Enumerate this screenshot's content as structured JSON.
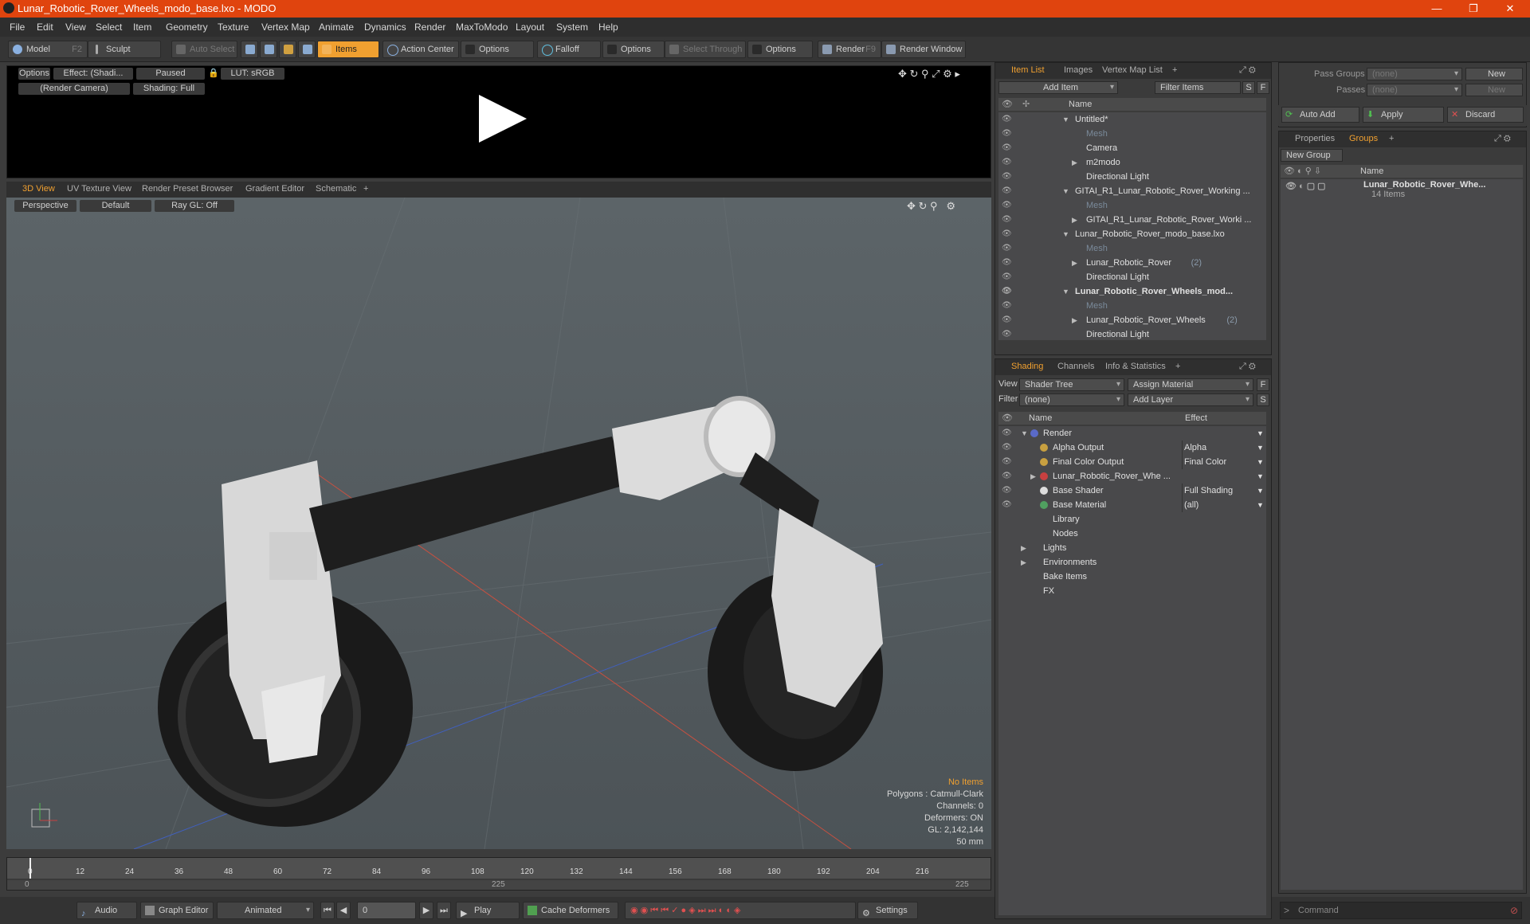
{
  "window": {
    "title": "Lunar_Robotic_Rover_Wheels_modo_base.lxo - MODO",
    "controls": [
      "—",
      "❐",
      "✕"
    ]
  },
  "menu": [
    "File",
    "Edit",
    "View",
    "Select",
    "Item",
    "Geometry",
    "Texture",
    "Vertex Map",
    "Animate",
    "Dynamics",
    "Render",
    "MaxToModo",
    "Layout",
    "System",
    "Help"
  ],
  "toolbar": {
    "model": "Model",
    "model_key": "F2",
    "sculpt": "Sculpt",
    "auto_select": "Auto Select",
    "items": "Items",
    "action_center": "Action Center",
    "options1": "Options",
    "falloff": "Falloff",
    "options2": "Options",
    "select_through": "Select Through",
    "options3": "Options",
    "render": "Render",
    "render_key": "F9",
    "render_window": "Render Window"
  },
  "preview": {
    "options": "Options",
    "effect": "Effect: (Shadi...",
    "paused": "Paused",
    "lut": "LUT: sRGB",
    "camera": "(Render Camera)",
    "shading": "Shading: Full"
  },
  "viewport_tabs": [
    "3D View",
    "UV Texture View",
    "Render Preset Browser",
    "Gradient Editor",
    "Schematic"
  ],
  "viewport": {
    "perspective": "Perspective",
    "default": "Default",
    "raygl": "Ray GL: Off",
    "no_items": "No Items",
    "polygons": "Polygons : Catmull-Clark",
    "channels": "Channels: 0",
    "deformers": "Deformers: ON",
    "gl": "GL: 2,142,144",
    "focal": "50 mm"
  },
  "timeline": {
    "ticks": [
      "0",
      "12",
      "24",
      "36",
      "48",
      "60",
      "72",
      "84",
      "96",
      "108",
      "120",
      "132",
      "144",
      "156",
      "168",
      "180",
      "192",
      "204",
      "216"
    ],
    "range_start": "0",
    "range_mid": "225",
    "range_end": "225"
  },
  "bottombar": {
    "audio": "Audio",
    "graph_editor": "Graph Editor",
    "animated": "Animated",
    "frame": "0",
    "play": "Play",
    "cache": "Cache Deformers",
    "settings": "Settings"
  },
  "item_list": {
    "tabs": [
      "Item List",
      "Images",
      "Vertex Map List"
    ],
    "add_item": "Add Item",
    "filter": "Filter Items",
    "s": "S",
    "f": "F",
    "col_name": "Name",
    "rows": [
      {
        "label": "Untitled*",
        "indent": 0,
        "arrow": "▼",
        "style": ""
      },
      {
        "label": "Mesh",
        "indent": 1,
        "arrow": "",
        "style": "dim"
      },
      {
        "label": "Camera",
        "indent": 1,
        "arrow": "",
        "style": ""
      },
      {
        "label": "m2modo",
        "indent": 1,
        "arrow": "▶",
        "style": ""
      },
      {
        "label": "Directional Light",
        "indent": 1,
        "arrow": "",
        "style": ""
      },
      {
        "label": "GITAI_R1_Lunar_Robotic_Rover_Working ...",
        "indent": 0,
        "arrow": "▼",
        "style": ""
      },
      {
        "label": "Mesh",
        "indent": 1,
        "arrow": "",
        "style": "dim"
      },
      {
        "label": "GITAI_R1_Lunar_Robotic_Rover_Worki ...",
        "indent": 1,
        "arrow": "▶",
        "style": ""
      },
      {
        "label": "Lunar_Robotic_Rover_modo_base.lxo",
        "indent": 0,
        "arrow": "▼",
        "style": ""
      },
      {
        "label": "Mesh",
        "indent": 1,
        "arrow": "",
        "style": "dim"
      },
      {
        "label": "Lunar_Robotic_Rover",
        "indent": 1,
        "arrow": "▶",
        "style": "",
        "count": "(2)"
      },
      {
        "label": "Directional Light",
        "indent": 1,
        "arrow": "",
        "style": ""
      },
      {
        "label": "Lunar_Robotic_Rover_Wheels_mod...",
        "indent": 0,
        "arrow": "▼",
        "style": "bold"
      },
      {
        "label": "Mesh",
        "indent": 1,
        "arrow": "",
        "style": "dim"
      },
      {
        "label": "Lunar_Robotic_Rover_Wheels",
        "indent": 1,
        "arrow": "▶",
        "style": "",
        "count": "(2)"
      },
      {
        "label": "Directional Light",
        "indent": 1,
        "arrow": "",
        "style": ""
      }
    ]
  },
  "shading": {
    "tabs": [
      "Shading",
      "Channels",
      "Info & Statistics"
    ],
    "view_label": "View",
    "view_value": "Shader Tree",
    "assign": "Assign Material",
    "f": "F",
    "filter_label": "Filter",
    "filter_value": "(none)",
    "add_layer": "Add Layer",
    "s": "S",
    "col_name": "Name",
    "col_effect": "Effect",
    "rows": [
      {
        "label": "Render",
        "indent": 0,
        "arrow": "▼",
        "effect": "",
        "icon": "#5a6ac8"
      },
      {
        "label": "Alpha Output",
        "indent": 1,
        "arrow": "",
        "effect": "Alpha",
        "icon": "#c8a040"
      },
      {
        "label": "Final Color Output",
        "indent": 1,
        "arrow": "",
        "effect": "Final Color",
        "icon": "#c8a040"
      },
      {
        "label": "Lunar_Robotic_Rover_Whe ...",
        "indent": 1,
        "arrow": "▶",
        "effect": "",
        "icon": "#c84040"
      },
      {
        "label": "Base Shader",
        "indent": 1,
        "arrow": "",
        "effect": "Full Shading",
        "icon": "#dddddd"
      },
      {
        "label": "Base Material",
        "indent": 1,
        "arrow": "",
        "effect": "(all)",
        "icon": "#50a060"
      },
      {
        "label": "Library",
        "indent": 1,
        "arrow": "",
        "effect": "",
        "icon": ""
      },
      {
        "label": "Nodes",
        "indent": 1,
        "arrow": "",
        "effect": "",
        "icon": ""
      },
      {
        "label": "Lights",
        "indent": 0,
        "arrow": "▶",
        "effect": "",
        "icon": ""
      },
      {
        "label": "Environments",
        "indent": 0,
        "arrow": "▶",
        "effect": "",
        "icon": ""
      },
      {
        "label": "Bake Items",
        "indent": 0,
        "arrow": "",
        "effect": "",
        "icon": ""
      },
      {
        "label": "FX",
        "indent": 0,
        "arrow": "",
        "effect": "",
        "icon": ""
      }
    ]
  },
  "pass": {
    "pass_groups": "Pass Groups",
    "pass_groups_value": "(none)",
    "new1": "New",
    "passes": "Passes",
    "passes_value": "(none)",
    "new2": "New",
    "auto_add": "Auto Add",
    "apply": "Apply",
    "discard": "Discard"
  },
  "groups": {
    "tabs": [
      "Properties",
      "Groups"
    ],
    "new_group": "New Group",
    "col_name": "Name",
    "item_name": "Lunar_Robotic_Rover_Whe...",
    "item_count": "14 Items"
  },
  "command": {
    "placeholder": "Command"
  }
}
